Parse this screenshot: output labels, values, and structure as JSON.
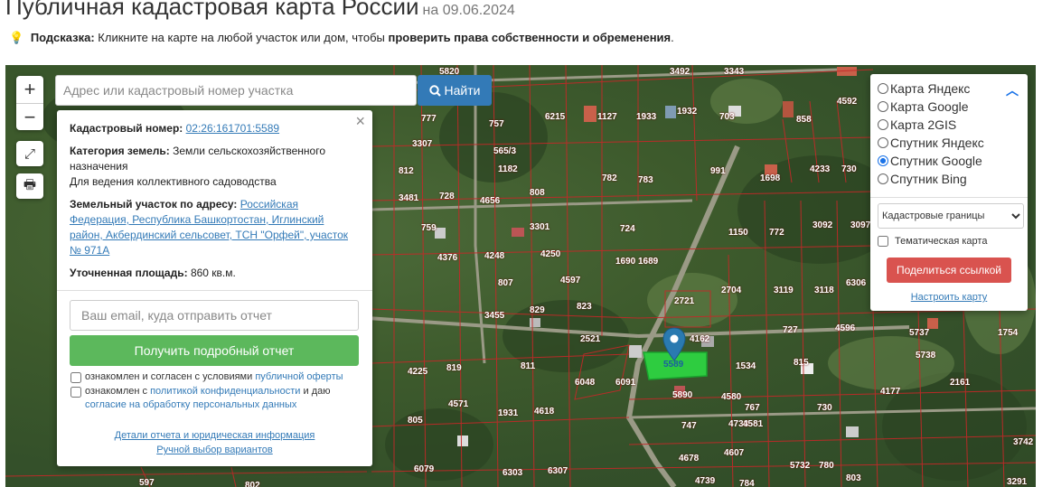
{
  "header": {
    "title": "Публичная кадастровая карта России",
    "date": "на 09.06.2024"
  },
  "hint": {
    "label": "Подсказка:",
    "text": "Кликните на карте на любой участок или дом, чтобы",
    "bold_text": "проверить права собственности и обременения",
    "end": "."
  },
  "map_controls": {
    "zoom_in": "+",
    "zoom_out": "−"
  },
  "search": {
    "placeholder": "Адрес или кадастровый номер участка",
    "button_label": "Найти"
  },
  "popup": {
    "close": "×",
    "cadastral_label": "Кадастровый номер:",
    "cadastral_number": "02:26:161701:5589",
    "category_label": "Категория земель:",
    "category_value": "Земли сельскохозяйственного назначения",
    "usage": "Для ведения коллективного садоводства",
    "address_label": "Земельный участок по адресу:",
    "address_value": "Российская Федерация, Республика Башкортостан, Иглинский район, Акбердинский сельсовет, ТСН \"Орфей\", участок № 971А",
    "area_label": "Уточненная площадь:",
    "area_value": "860 кв.м.",
    "email_placeholder": "Ваш email, куда отправить отчет",
    "report_button": "Получить подробный отчет",
    "consent1_text": "ознакомлен и согласен с условиями",
    "consent1_link": "публичной оферты",
    "consent2_text": "ознакомлен с",
    "consent2_link": "политикой конфиденциальности",
    "consent2_mid": "и даю",
    "consent2_link2": "согласие на обработку персональных данных",
    "details_link": "Детали отчета и юридическая информация",
    "manual_link": "Ручной выбор вариантов"
  },
  "layers": {
    "options": [
      {
        "label": "Карта Яндекс",
        "selected": false
      },
      {
        "label": "Карта Google",
        "selected": false
      },
      {
        "label": "Карта 2GIS",
        "selected": false
      },
      {
        "label": "Спутник Яндекс",
        "selected": false
      },
      {
        "label": "Спутник Google",
        "selected": true
      },
      {
        "label": "Спутник Bing",
        "selected": false
      }
    ],
    "boundaries_select": "Кадастровые границы",
    "thematic_label": "Тематическая карта",
    "share_button": "Поделиться ссылкой",
    "configure_link": "Настроить карту"
  },
  "selected_plot_label": "5589",
  "map_plot_numbers": [
    "5820",
    "3492",
    "3343",
    "777",
    "757",
    "6215",
    "1127",
    "1933",
    "1932",
    "703",
    "858",
    "4592",
    "3307",
    "565/3",
    "1182",
    "991",
    "1698",
    "4233",
    "730",
    "812",
    "3481",
    "728",
    "4656",
    "808",
    "782",
    "783",
    "759",
    "3301",
    "724",
    "1150",
    "772",
    "3092",
    "3097",
    "4376",
    "4248",
    "4250",
    "1690",
    "1689",
    "807",
    "4597",
    "2721",
    "2704",
    "3119",
    "3118",
    "6306",
    "3455",
    "829",
    "823",
    "2521",
    "4162",
    "727",
    "4596",
    "5737",
    "1754",
    "819",
    "811",
    "1534",
    "815",
    "5738",
    "4225",
    "6048",
    "6091",
    "5890",
    "4580",
    "2161",
    "4177",
    "4571",
    "1931",
    "4618",
    "767",
    "730",
    "805",
    "4733",
    "747",
    "4581",
    "4607",
    "4678",
    "5732",
    "780",
    "6079",
    "6303",
    "6307",
    "4739",
    "784",
    "803",
    "3742",
    "3291",
    "597",
    "802"
  ]
}
